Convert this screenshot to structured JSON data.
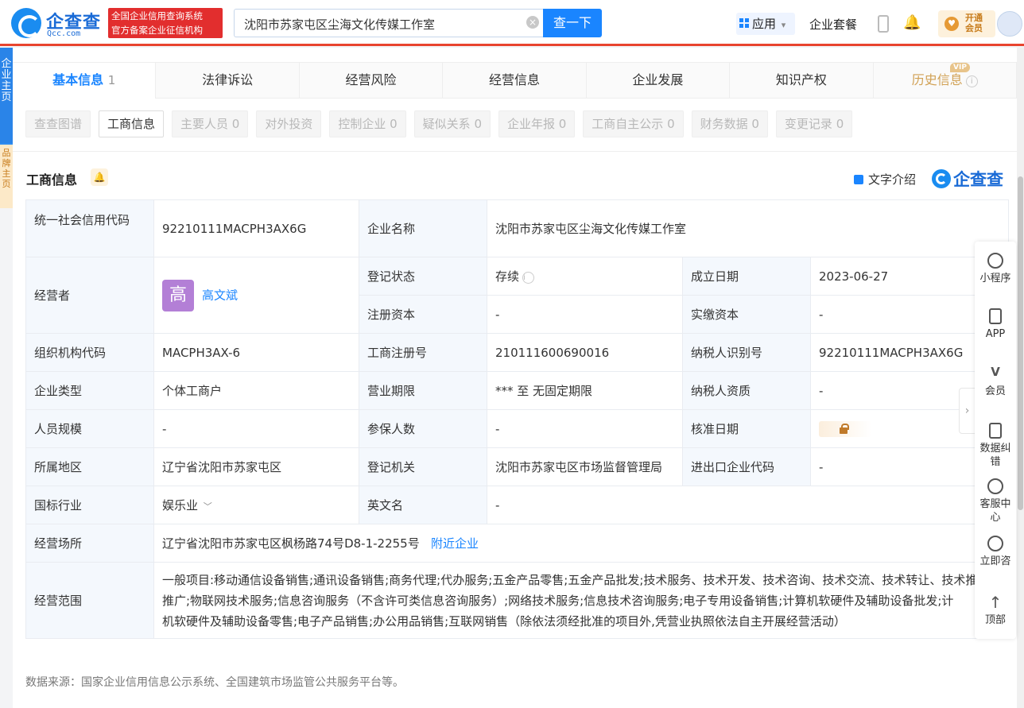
{
  "header": {
    "logo_name": "企查查",
    "logo_url": "Qcc.com",
    "badge_line1": "全国企业信用查询系统",
    "badge_line2": "官方备案企业征信机构",
    "search_value": "沈阳市苏家屯区尘海文化传媒工作室",
    "search_button": "查一下",
    "apps_label": "应用",
    "suite_label": "企业套餐",
    "vip_line1": "开通",
    "vip_line2": "会员"
  },
  "left_drawer": {
    "top": "企业主页",
    "bottom": "品牌主页"
  },
  "tabs": [
    {
      "label": "基本信息",
      "count": "1"
    },
    {
      "label": "法律诉讼"
    },
    {
      "label": "经营风险"
    },
    {
      "label": "经营信息"
    },
    {
      "label": "企业发展"
    },
    {
      "label": "知识产权"
    },
    {
      "label": "历史信息",
      "tag": "VIP"
    }
  ],
  "subtabs": [
    "查查图谱",
    "工商信息",
    "主要人员 0",
    "对外投资",
    "控制企业 0",
    "疑似关系 0",
    "企业年报 0",
    "工商自主公示 0",
    "财务数据 0",
    "变更记录 0"
  ],
  "section": {
    "title": "工商信息",
    "text_intro": "文字介绍",
    "brand": "企查查"
  },
  "info": {
    "credit_code_label": "统一社会信用代码",
    "credit_code": "92210111MACPH3AX6G",
    "company_name_label": "企业名称",
    "company_name": "沈阳市苏家屯区尘海文化传媒工作室",
    "operator_label": "经营者",
    "operator_avatar": "高",
    "operator_name": "高文斌",
    "reg_status_label": "登记状态",
    "reg_status": "存续",
    "found_date_label": "成立日期",
    "found_date": "2023-06-27",
    "reg_capital_label": "注册资本",
    "reg_capital": "-",
    "paid_capital_label": "实缴资本",
    "paid_capital": "-",
    "org_code_label": "组织机构代码",
    "org_code": "MACPH3AX-6",
    "reg_no_label": "工商注册号",
    "reg_no": "210111600690016",
    "tax_id_label": "纳税人识别号",
    "tax_id": "92210111MACPH3AX6G",
    "type_label": "企业类型",
    "type": "个体工商户",
    "term_label": "营业期限",
    "term": "*** 至 无固定期限",
    "tax_qual_label": "纳税人资质",
    "tax_qual": "-",
    "staff_label": "人员规模",
    "staff": "-",
    "insured_label": "参保人数",
    "insured": "-",
    "approve_label": "核准日期",
    "region_label": "所属地区",
    "region": "辽宁省沈阳市苏家屯区",
    "authority_label": "登记机关",
    "authority": "沈阳市苏家屯区市场监督管理局",
    "ie_code_label": "进出口企业代码",
    "ie_code": "-",
    "industry_label": "国标行业",
    "industry": "娱乐业",
    "en_name_label": "英文名",
    "en_name": "-",
    "address_label": "经营场所",
    "address": "辽宁省沈阳市苏家屯区枫杨路74号D8-1-2255号",
    "nearby": "附近企业",
    "scope_label": "经营范围",
    "scope_line1": "一般项目:移动通信设备销售;通讯设备销售;商务代理;代办服务;五金产品零售;五金产品批发;技术服务、技术开发、技术咨询、技术交流、技术转让、技术推",
    "scope_line2": "推广;物联网技术服务;信息咨询服务（不含许可类信息咨询服务）;网络技术服务;信息技术咨询服务;电子专用设备销售;计算机软硬件及辅助设备批发;计",
    "scope_line3": "机软硬件及辅助设备零售;电子产品销售;办公用品销售;互联网销售（除依法须经批准的项目外,凭营业执照依法自主开展经营活动）"
  },
  "footnote": "数据来源：国家企业信用信息公示系统、全国建筑市场监管公共服务平台等。",
  "rightbar": [
    "小程序",
    "APP",
    "会员",
    "数据纠错",
    "客服中心",
    "立即咨询",
    "顶部"
  ]
}
